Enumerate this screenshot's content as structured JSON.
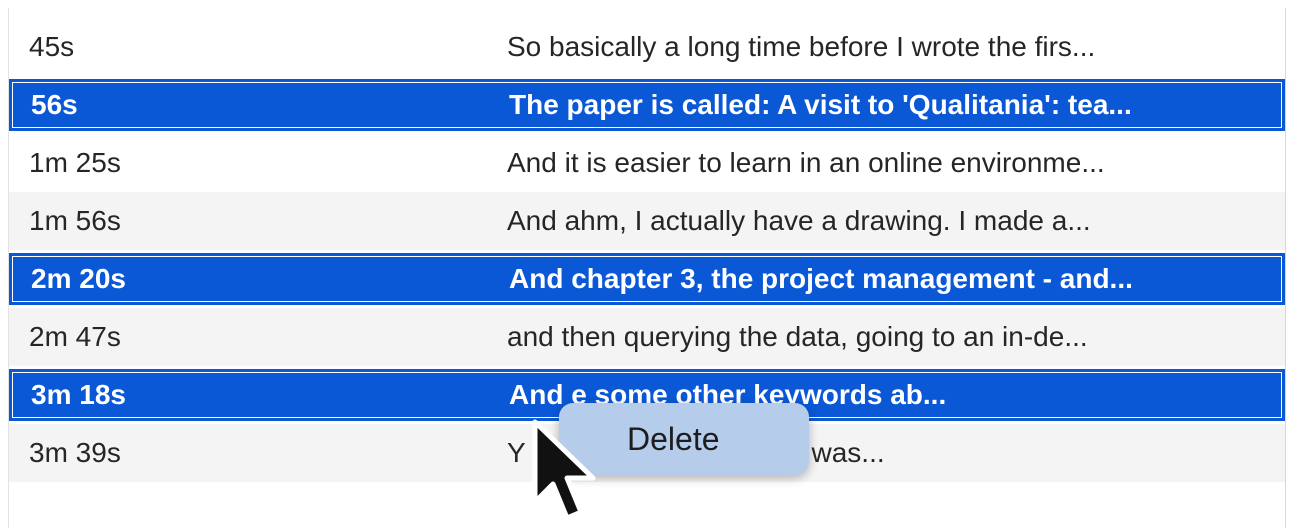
{
  "transcript": {
    "rows": [
      {
        "time": "45s",
        "text": "So basically a long time before I wrote the firs...",
        "selected": false
      },
      {
        "time": "56s",
        "text": "The paper is called: A visit to 'Qualitania': tea...",
        "selected": true
      },
      {
        "time": "1m 25s",
        "text": "And it is easier to learn in an online environme...",
        "selected": false
      },
      {
        "time": "1m 56s",
        "text": "And ahm, I actually have a drawing. I made a...",
        "selected": false
      },
      {
        "time": "2m 20s",
        "text": "And chapter 3, the project management - and...",
        "selected": true
      },
      {
        "time": "2m 47s",
        "text": "and then querying the data, going to an in-de...",
        "selected": false
      },
      {
        "time": "3m 18s",
        "text": "And                    e some other keywords ab...",
        "selected": true
      },
      {
        "time": "3m 39s",
        "text": "Y                         ily where the first idea was...",
        "selected": false
      }
    ]
  },
  "context_menu": {
    "delete_label": "Delete"
  },
  "colors": {
    "selection": "#0a58d6",
    "menu_bg": "#b5ccea",
    "row_alt": "#f4f4f4"
  },
  "icons": {
    "cursor": "arrow-pointer-icon"
  }
}
